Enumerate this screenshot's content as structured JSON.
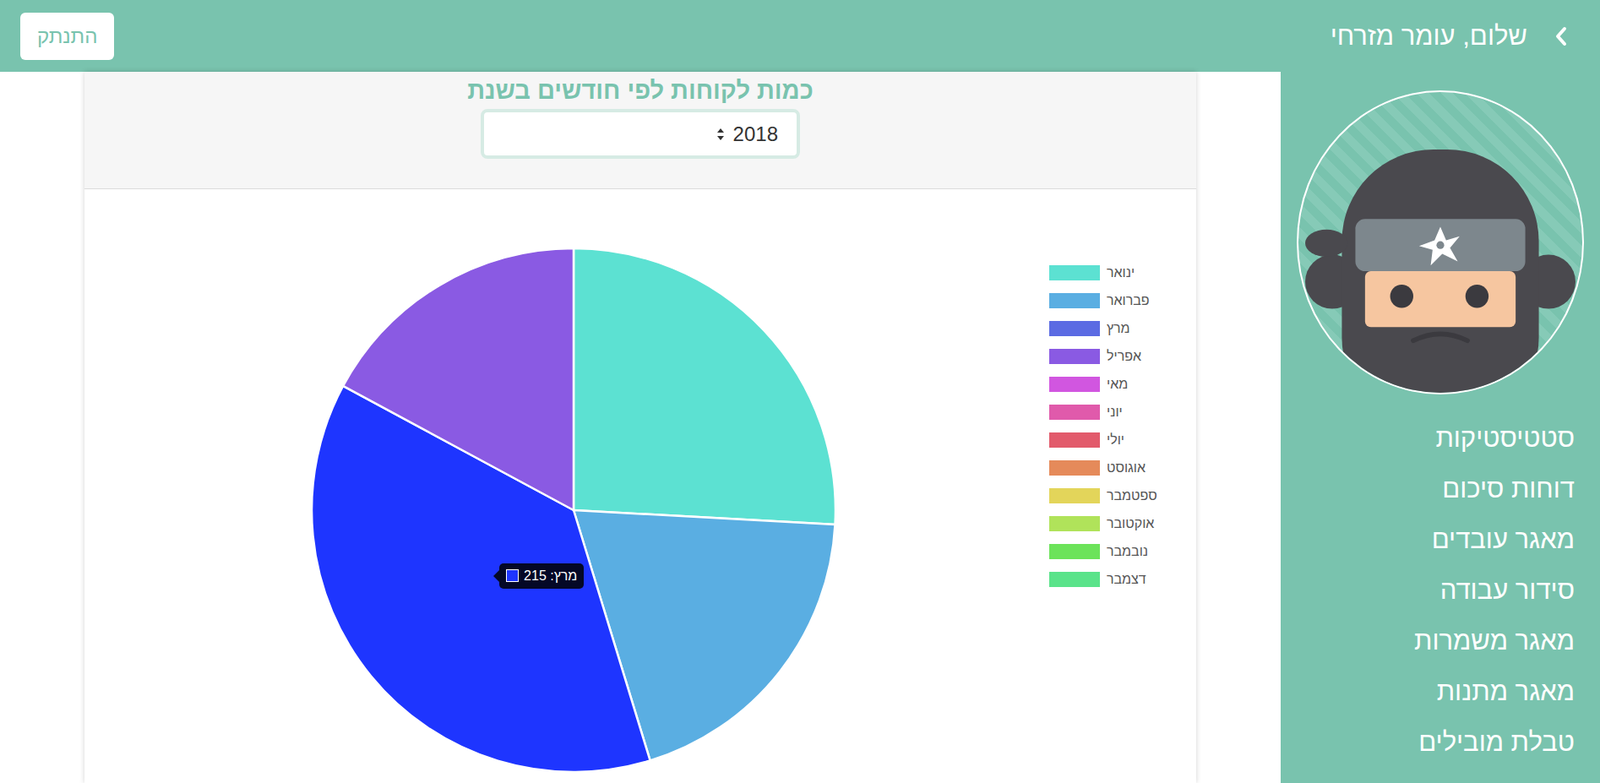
{
  "topbar": {
    "greeting": "שלום, עומר מזרחי",
    "logout": "התנתק"
  },
  "sidebar": {
    "items": [
      "סטטיסטיקות",
      "דוחות סיכום",
      "מאגר עובדים",
      "סידור עבודה",
      "מאגר משמרות",
      "מאגר מתנות",
      "טבלת מובילים"
    ]
  },
  "chart": {
    "title": "כמות לקוחות לפי חודשים בשנת",
    "year": "2018",
    "highlight_color": "#1e35ff",
    "tooltip": "מרץ: 215",
    "months": [
      {
        "name": "ינואר",
        "value": 148,
        "color": "#5ce1d2",
        "highlighted": false
      },
      {
        "name": "פברואר",
        "value": 111,
        "color": "#5aaee2",
        "highlighted": false
      },
      {
        "name": "מרץ",
        "value": 215,
        "color": "#5b6be3",
        "highlighted": true
      },
      {
        "name": "אפריל",
        "value": 98,
        "color": "#8a5ae3",
        "highlighted": false
      },
      {
        "name": "מאי",
        "value": 0,
        "color": "#d156e0",
        "highlighted": false
      },
      {
        "name": "יוני",
        "value": 0,
        "color": "#e05aab",
        "highlighted": false
      },
      {
        "name": "יולי",
        "value": 0,
        "color": "#e25a6b",
        "highlighted": false
      },
      {
        "name": "אוגוסט",
        "value": 0,
        "color": "#e58a5a",
        "highlighted": false
      },
      {
        "name": "ספטמבר",
        "value": 0,
        "color": "#e3d55a",
        "highlighted": false
      },
      {
        "name": "אוקטובר",
        "value": 0,
        "color": "#b0e35a",
        "highlighted": false
      },
      {
        "name": "נובמבר",
        "value": 0,
        "color": "#6ce35a",
        "highlighted": false
      },
      {
        "name": "דצמבר",
        "value": 0,
        "color": "#5ae38a",
        "highlighted": false
      }
    ]
  }
}
